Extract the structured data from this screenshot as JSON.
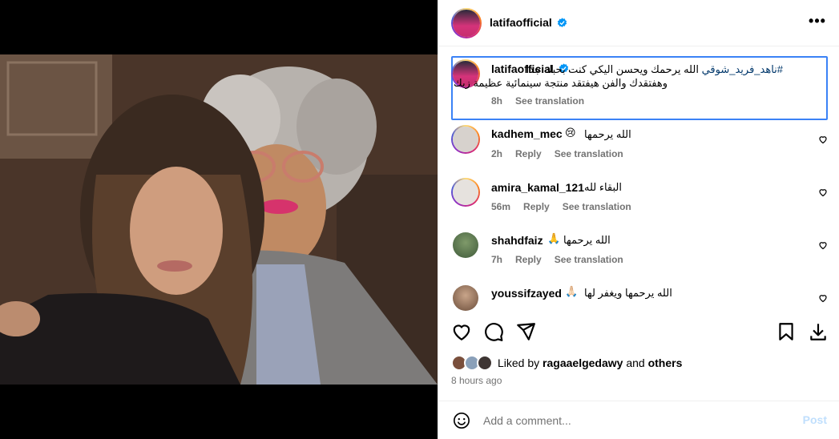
{
  "header": {
    "username": "latifaofficial",
    "more_label": "•••"
  },
  "caption": {
    "username": "latifaofficial",
    "hashtag": "#ناهد_فريد_شوقي",
    "line1_rest": " الله يرحمك ويحسن اليكي كنت بحبك جدا",
    "line2": "وهفتقدك والفن هيفتقد منتجة سينمائية عظيمة زيك",
    "time": "8h",
    "see_translation": "See translation"
  },
  "comments": [
    {
      "username": "kadhem_mec",
      "text": "الله يرحمها",
      "emoji": "😢",
      "time": "2h",
      "reply": "Reply",
      "see_translation": "See translation"
    },
    {
      "username": "amira_kamal_121",
      "text": "البقاء لله",
      "emoji": "",
      "time": "56m",
      "reply": "Reply",
      "see_translation": "See translation"
    },
    {
      "username": "shahdfaiz",
      "text": "الله يرحمها",
      "emoji": "🙏",
      "time": "7h",
      "reply": "Reply",
      "see_translation": "See translation"
    },
    {
      "username": "youssifzayed",
      "text": "الله يرحمها ويغفر لها",
      "emoji": "🙏🏻",
      "time": "",
      "reply": "",
      "see_translation": ""
    }
  ],
  "likes": {
    "prefix": "Liked by ",
    "user": "ragaaelgedawy",
    "middle": " and ",
    "others": "others"
  },
  "timestamp": "8 hours ago",
  "add_comment": {
    "placeholder": "Add a comment...",
    "post_label": "Post"
  },
  "colors": {
    "accent_blue": "#0095f6",
    "highlight_border": "#3b82f6",
    "muted_text": "#737373",
    "post_disabled": "#c0dffd"
  }
}
